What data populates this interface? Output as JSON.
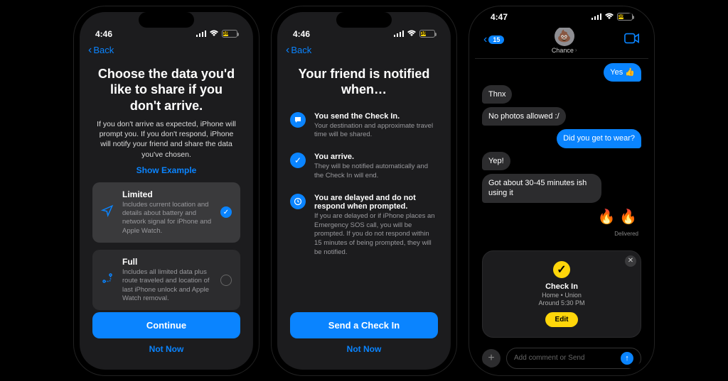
{
  "phones": {
    "left": {
      "status": {
        "time": "4:46",
        "battery_pct": "38"
      },
      "back_label": "Back",
      "title": "Choose the data you'd like to share if you don't arrive.",
      "subtitle": "If you don't arrive as expected, iPhone will prompt you. If you don't respond, iPhone will notify your friend and share the data you've chosen.",
      "show_example": "Show Example",
      "options": [
        {
          "title": "Limited",
          "desc": "Includes current location and details about battery and network signal for iPhone and Apple Watch.",
          "selected": true
        },
        {
          "title": "Full",
          "desc": "Includes all limited data plus route traveled and location of last iPhone unlock and Apple Watch removal.",
          "selected": false
        }
      ],
      "primary": "Continue",
      "secondary": "Not Now"
    },
    "middle": {
      "status": {
        "time": "4:46",
        "battery_pct": "38"
      },
      "back_label": "Back",
      "title": "Your friend is notified when…",
      "items": [
        {
          "title": "You send the Check In.",
          "desc": "Your destination and approximate travel time will be shared."
        },
        {
          "title": "You arrive.",
          "desc": "They will be notified automatically and the Check In will end."
        },
        {
          "title": "You are delayed and do not respond when prompted.",
          "desc": "If you are delayed or if iPhone places an Emergency SOS call, you will be prompted. If you do not respond within 15 minutes of being prompted, they will be notified."
        }
      ],
      "primary": "Send a Check In",
      "secondary": "Not Now"
    },
    "right": {
      "status": {
        "time": "4:47",
        "battery_pct": "38"
      },
      "header": {
        "unread_badge": "15",
        "contact_name": "Chance",
        "avatar_emoji": "💩"
      },
      "messages": [
        {
          "side": "sent",
          "text": "Yes 👍"
        },
        {
          "side": "recv",
          "text": "Thnx"
        },
        {
          "side": "recv",
          "text": "No photos allowed :/"
        },
        {
          "side": "sent",
          "text": "Did you get to wear?"
        },
        {
          "side": "recv",
          "text": "Yep!"
        },
        {
          "side": "recv",
          "text": "Got about 30-45 minutes ish using it"
        }
      ],
      "reaction": "🔥 🔥",
      "delivered": "Delivered",
      "checkin": {
        "title": "Check In",
        "line1": "Home • Union",
        "line2": "Around 5:30 PM",
        "edit": "Edit"
      },
      "compose_placeholder": "Add comment or Send"
    }
  }
}
